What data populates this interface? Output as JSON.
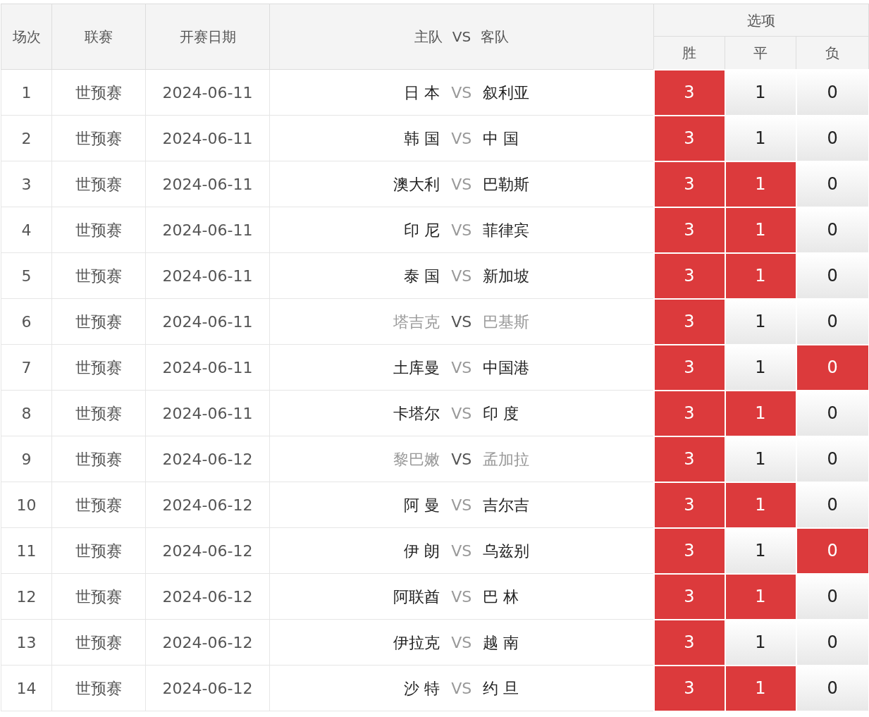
{
  "header": {
    "no": "场次",
    "league": "联赛",
    "date": "开赛日期",
    "home": "主队",
    "vs": "VS",
    "away": "客队",
    "options_group": "选项",
    "options": [
      "胜",
      "平",
      "负"
    ]
  },
  "rows": [
    {
      "no": "1",
      "league": "世预赛",
      "date": "2024-06-11",
      "home": "日 本",
      "vs": "VS",
      "away": "叙利亚",
      "dimmed": false,
      "options": [
        {
          "label": "3",
          "selected": true
        },
        {
          "label": "1",
          "selected": false
        },
        {
          "label": "0",
          "selected": false
        }
      ]
    },
    {
      "no": "2",
      "league": "世预赛",
      "date": "2024-06-11",
      "home": "韩 国",
      "vs": "VS",
      "away": "中 国",
      "dimmed": false,
      "options": [
        {
          "label": "3",
          "selected": true
        },
        {
          "label": "1",
          "selected": false
        },
        {
          "label": "0",
          "selected": false
        }
      ]
    },
    {
      "no": "3",
      "league": "世预赛",
      "date": "2024-06-11",
      "home": "澳大利",
      "vs": "VS",
      "away": "巴勒斯",
      "dimmed": false,
      "options": [
        {
          "label": "3",
          "selected": true
        },
        {
          "label": "1",
          "selected": true
        },
        {
          "label": "0",
          "selected": false
        }
      ]
    },
    {
      "no": "4",
      "league": "世预赛",
      "date": "2024-06-11",
      "home": "印 尼",
      "vs": "VS",
      "away": "菲律宾",
      "dimmed": false,
      "options": [
        {
          "label": "3",
          "selected": true
        },
        {
          "label": "1",
          "selected": true
        },
        {
          "label": "0",
          "selected": false
        }
      ]
    },
    {
      "no": "5",
      "league": "世预赛",
      "date": "2024-06-11",
      "home": "泰 国",
      "vs": "VS",
      "away": "新加坡",
      "dimmed": false,
      "options": [
        {
          "label": "3",
          "selected": true
        },
        {
          "label": "1",
          "selected": true
        },
        {
          "label": "0",
          "selected": false
        }
      ]
    },
    {
      "no": "6",
      "league": "世预赛",
      "date": "2024-06-11",
      "home": "塔吉克",
      "vs": "VS",
      "away": "巴基斯",
      "dimmed": true,
      "options": [
        {
          "label": "3",
          "selected": true
        },
        {
          "label": "1",
          "selected": false
        },
        {
          "label": "0",
          "selected": false
        }
      ]
    },
    {
      "no": "7",
      "league": "世预赛",
      "date": "2024-06-11",
      "home": "土库曼",
      "vs": "VS",
      "away": "中国港",
      "dimmed": false,
      "options": [
        {
          "label": "3",
          "selected": true
        },
        {
          "label": "1",
          "selected": false
        },
        {
          "label": "0",
          "selected": true
        }
      ]
    },
    {
      "no": "8",
      "league": "世预赛",
      "date": "2024-06-11",
      "home": "卡塔尔",
      "vs": "VS",
      "away": "印 度",
      "dimmed": false,
      "options": [
        {
          "label": "3",
          "selected": true
        },
        {
          "label": "1",
          "selected": true
        },
        {
          "label": "0",
          "selected": false
        }
      ]
    },
    {
      "no": "9",
      "league": "世预赛",
      "date": "2024-06-12",
      "home": "黎巴嫩",
      "vs": "VS",
      "away": "孟加拉",
      "dimmed": true,
      "options": [
        {
          "label": "3",
          "selected": true
        },
        {
          "label": "1",
          "selected": false
        },
        {
          "label": "0",
          "selected": false
        }
      ]
    },
    {
      "no": "10",
      "league": "世预赛",
      "date": "2024-06-12",
      "home": "阿 曼",
      "vs": "VS",
      "away": "吉尔吉",
      "dimmed": false,
      "options": [
        {
          "label": "3",
          "selected": true
        },
        {
          "label": "1",
          "selected": true
        },
        {
          "label": "0",
          "selected": false
        }
      ]
    },
    {
      "no": "11",
      "league": "世预赛",
      "date": "2024-06-12",
      "home": "伊 朗",
      "vs": "VS",
      "away": "乌兹别",
      "dimmed": false,
      "options": [
        {
          "label": "3",
          "selected": true
        },
        {
          "label": "1",
          "selected": false
        },
        {
          "label": "0",
          "selected": true
        }
      ]
    },
    {
      "no": "12",
      "league": "世预赛",
      "date": "2024-06-12",
      "home": "阿联酋",
      "vs": "VS",
      "away": "巴 林",
      "dimmed": false,
      "options": [
        {
          "label": "3",
          "selected": true
        },
        {
          "label": "1",
          "selected": true
        },
        {
          "label": "0",
          "selected": false
        }
      ]
    },
    {
      "no": "13",
      "league": "世预赛",
      "date": "2024-06-12",
      "home": "伊拉克",
      "vs": "VS",
      "away": "越 南",
      "dimmed": false,
      "options": [
        {
          "label": "3",
          "selected": true
        },
        {
          "label": "1",
          "selected": false
        },
        {
          "label": "0",
          "selected": false
        }
      ]
    },
    {
      "no": "14",
      "league": "世预赛",
      "date": "2024-06-12",
      "home": "沙 特",
      "vs": "VS",
      "away": "约 旦",
      "dimmed": false,
      "options": [
        {
          "label": "3",
          "selected": true
        },
        {
          "label": "1",
          "selected": true
        },
        {
          "label": "0",
          "selected": false
        }
      ]
    }
  ]
}
